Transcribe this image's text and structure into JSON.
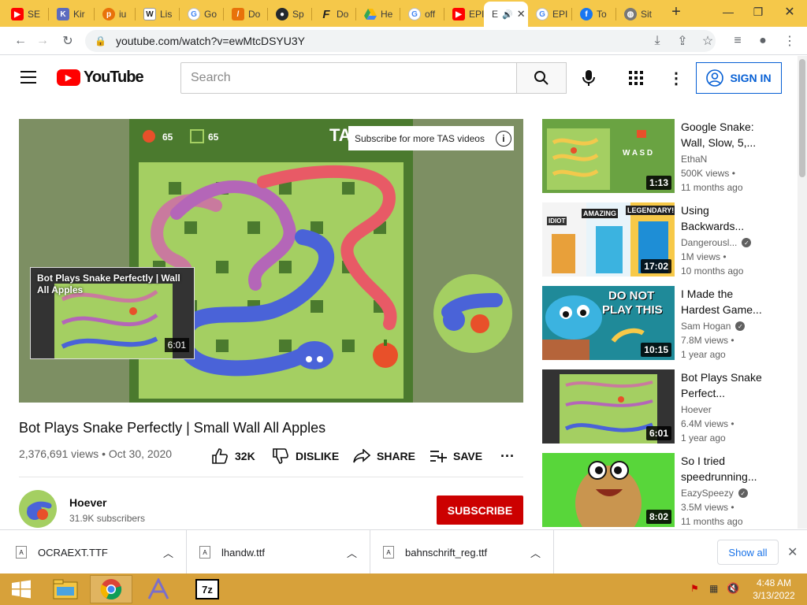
{
  "tabs": [
    {
      "label": "SE",
      "icon": "youtube-icon",
      "color": "#ff0000"
    },
    {
      "label": "Kir",
      "icon": "ks-icon",
      "color": "#5b6bbf"
    },
    {
      "label": "iu",
      "icon": "pinterest-icon",
      "color": "#e60023"
    },
    {
      "label": "Lis",
      "icon": "wikipedia-icon",
      "color": "#222222"
    },
    {
      "label": "Go",
      "icon": "google-icon",
      "color": "#4285f4"
    },
    {
      "label": "Do",
      "icon": "doc-icon",
      "color": "#e8710a"
    },
    {
      "label": "Sp",
      "icon": "github-icon",
      "color": "#24292e"
    },
    {
      "label": "Do",
      "icon": "f-icon",
      "color": "#222222"
    },
    {
      "label": "He",
      "icon": "drive-icon",
      "color": "#34a853"
    },
    {
      "label": "off",
      "icon": "google-icon",
      "color": "#4285f4"
    },
    {
      "label": "EPI",
      "icon": "youtube-icon",
      "color": "#ff0000"
    },
    {
      "label": "E",
      "icon": "audio-icon",
      "color": "#555555"
    },
    {
      "label": "EPI",
      "icon": "google-icon",
      "color": "#4285f4"
    },
    {
      "label": "To",
      "icon": "facebook-icon",
      "color": "#1877f2"
    },
    {
      "label": "Sit",
      "icon": "globe-icon",
      "color": "#666666"
    }
  ],
  "browser": {
    "url": "youtube.com/watch?v=ewMtcDSYU3Y"
  },
  "header": {
    "logo_text": "YouTube",
    "search_placeholder": "Search",
    "signin_label": "SIGN IN"
  },
  "player": {
    "score_apples": "65",
    "score_walls": "65",
    "overlay_text": "TAS",
    "info_card": "Subscribe for more TAS videos",
    "endcard_title": "Bot Plays Snake Perfectly | Wall All Apples",
    "endcard_duration": "6:01"
  },
  "video": {
    "title": "Bot Plays Snake Perfectly | Small Wall All Apples",
    "views_date": "2,376,691 views • Oct 30, 2020",
    "likes": "32K",
    "dislike": "DISLIKE",
    "share": "SHARE",
    "save": "SAVE",
    "channel": "Hoever",
    "subscribers": "31.9K subscribers",
    "subscribe_label": "SUBSCRIBE"
  },
  "recommendations": [
    {
      "title": "Google Snake: Wall, Slow, 5,...",
      "channel": "EthaN",
      "verified": false,
      "views": "500K views •",
      "age": "11 months ago",
      "duration": "1:13"
    },
    {
      "title": "Using Backwards...",
      "channel": "Dangerousl...",
      "verified": true,
      "views": "1M views •",
      "age": "10 months ago",
      "duration": "17:02"
    },
    {
      "title": "I Made the Hardest Game...",
      "channel": "Sam Hogan",
      "verified": true,
      "views": "7.8M views •",
      "age": "1 year ago",
      "duration": "10:15"
    },
    {
      "title": "Bot Plays Snake Perfect...",
      "channel": "Hoever",
      "verified": false,
      "views": "6.4M views •",
      "age": "1 year ago",
      "duration": "6:01"
    },
    {
      "title": "So I tried speedrunning...",
      "channel": "EazySpeezy",
      "verified": true,
      "views": "3.5M views •",
      "age": "11 months ago",
      "duration": "8:02"
    }
  ],
  "thumb_text": {
    "idiot": "IDIOT",
    "amazing": "AMAZING",
    "legendary": "LEGENDARY!",
    "do_not": "DO NOT",
    "play_this": "PLAY THIS",
    "wasd": "W A S D"
  },
  "downloads": {
    "items": [
      "OCRAEXT.TTF",
      "lhandw.ttf",
      "bahnschrift_reg.ttf"
    ],
    "show_all": "Show all"
  },
  "taskbar": {
    "time": "4:48 AM",
    "date": "3/13/2022"
  }
}
